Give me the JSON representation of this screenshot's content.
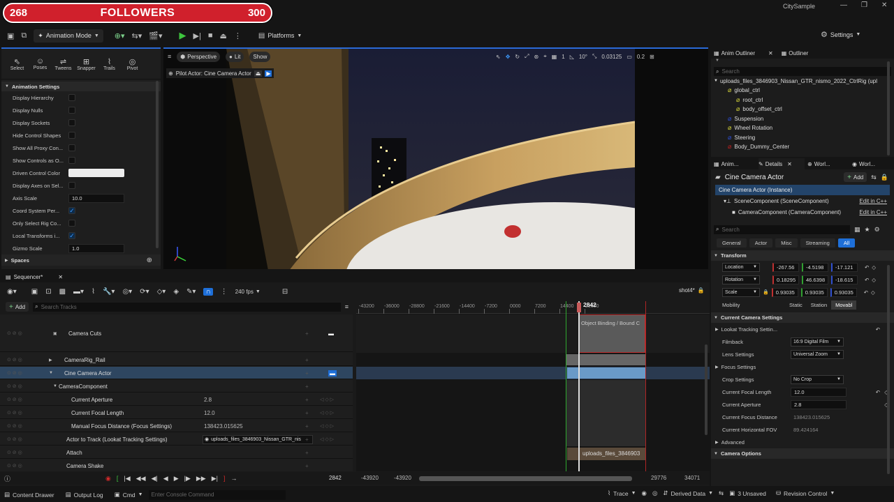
{
  "banner": {
    "left": "268",
    "label": "FOLLOWERS",
    "right": "300",
    "progress": 0.5
  },
  "window": {
    "title": "CitySample"
  },
  "toolbar": {
    "mode": "Animation Mode",
    "platforms": "Platforms",
    "settings": "Settings"
  },
  "anim_panel": {
    "tools": [
      "Select",
      "Poses",
      "Tweens",
      "Snapper",
      "Trails",
      "Pivot"
    ],
    "section": "Animation Settings",
    "rows": [
      {
        "label": "Display Hierarchy",
        "type": "check",
        "checked": false
      },
      {
        "label": "Display Nulls",
        "type": "check",
        "checked": false
      },
      {
        "label": "Display Sockets",
        "type": "check",
        "checked": false
      },
      {
        "label": "Hide Control Shapes",
        "type": "check",
        "checked": false
      },
      {
        "label": "Show All Proxy Con...",
        "type": "check",
        "checked": false
      },
      {
        "label": "Show Controls as O...",
        "type": "check",
        "checked": false
      },
      {
        "label": "Driven Control Color",
        "type": "color"
      },
      {
        "label": "Display Axes on Sel...",
        "type": "check",
        "checked": false
      },
      {
        "label": "Axis Scale",
        "type": "value",
        "value": "10.0"
      },
      {
        "label": "Coord System Per...",
        "type": "check",
        "checked": true
      },
      {
        "label": "Only Select Rig Co...",
        "type": "check",
        "checked": false
      },
      {
        "label": "Local Transforms i...",
        "type": "check",
        "checked": true
      },
      {
        "label": "Gizmo Scale",
        "type": "value",
        "value": "1.0"
      }
    ],
    "spaces": "Spaces"
  },
  "viewport": {
    "perspective": "Perspective",
    "lit": "Lit",
    "show": "Show",
    "pilot": "Pilot Actor: Cine Camera Actor",
    "grid": "1",
    "angle": "10°",
    "scale": "0.03125",
    "speed": "0.2"
  },
  "outliner": {
    "tab1": "Anim Outliner",
    "tab2": "Outliner",
    "search": "Search",
    "root": "uploads_files_3846903_Nissan_GTR_nismo_2022_CtrlRig (upl",
    "items": [
      {
        "label": "global_ctrl",
        "color": "#d8d83a",
        "indent": 1
      },
      {
        "label": "root_ctrl",
        "color": "#d8d83a",
        "indent": 2
      },
      {
        "label": "body_offset_ctrl",
        "color": "#d8d83a",
        "indent": 2
      },
      {
        "label": "Suspension",
        "color": "#2d4fd8",
        "indent": 1
      },
      {
        "label": "Wheel Rotation",
        "color": "#d8d83a",
        "indent": 1
      },
      {
        "label": "Steering",
        "color": "#2d4fd8",
        "indent": 1
      },
      {
        "label": "Body_Dummy_Center",
        "color": "#c02020",
        "indent": 1
      }
    ]
  },
  "details": {
    "tabs": [
      "Anim...",
      "Details",
      "Worl...",
      "Worl..."
    ],
    "title": "Cine Camera Actor",
    "add": "Add",
    "instance": "Cine Camera Actor (Instance)",
    "components": [
      {
        "label": "SceneComponent (SceneComponent)",
        "edit": "Edit in C++"
      },
      {
        "label": "CameraComponent (CameraComponent)",
        "edit": "Edit in C++"
      }
    ],
    "search": "Search",
    "filters": [
      "General",
      "Actor",
      "Misc",
      "Streaming",
      "All"
    ],
    "transform": "Transform",
    "location": {
      "label": "Location",
      "x": "-267.56",
      "y": "-4.5198",
      "z": "-17.121"
    },
    "rotation": {
      "label": "Rotation",
      "x": "0.18295",
      "y": "46.6398",
      "z": "-18.615"
    },
    "scale": {
      "label": "Scale",
      "x": "0.93035",
      "y": "0.93035",
      "z": "0.93035"
    },
    "mobility": {
      "label": "Mobility",
      "options": [
        "Static",
        "Station",
        "Movabl"
      ]
    },
    "camera_settings": "Current Camera Settings",
    "rows": [
      {
        "label": "Lookat Tracking Settin...",
        "value": "",
        "kind": "group"
      },
      {
        "label": "Filmback",
        "value": "16:9 Digital Film",
        "kind": "drop"
      },
      {
        "label": "Lens Settings",
        "value": "Universal Zoom",
        "kind": "drop"
      },
      {
        "label": "Focus Settings",
        "value": "",
        "kind": "group"
      },
      {
        "label": "Crop Settings",
        "value": "No Crop",
        "kind": "drop"
      },
      {
        "label": "Current Focal Length",
        "value": "12.0",
        "kind": "field"
      },
      {
        "label": "Current Aperture",
        "value": "2.8",
        "kind": "field"
      },
      {
        "label": "Current Focus Distance",
        "value": "138423.015625",
        "kind": "ro"
      },
      {
        "label": "Current Horizontal FOV",
        "value": "89.424164",
        "kind": "ro"
      },
      {
        "label": "Advanced",
        "value": "",
        "kind": "group"
      }
    ],
    "camera_options": "Camera Options"
  },
  "sequencer": {
    "tab": "Sequencer*",
    "fps": "240 fps",
    "shot": "shot4*",
    "add": "Add",
    "search": "Search Tracks",
    "frame": "2842",
    "ruler": [
      "-43200",
      "-36000",
      "-28800",
      "-21600",
      "-14400",
      "-7200",
      "0000",
      "7200",
      "14400",
      "21600"
    ],
    "tracks": [
      {
        "label": "Camera Cuts"
      },
      {
        "label": "CameraRig_Rail"
      },
      {
        "label": "Cine Camera Actor"
      },
      {
        "label": "CameraComponent"
      },
      {
        "label": "Current Aperture",
        "value": "2.8"
      },
      {
        "label": "Current Focal Length",
        "value": "12.0"
      },
      {
        "label": "Manual Focus Distance (Focus Settings)",
        "value": "138423.015625"
      },
      {
        "label": "Actor to Track (Lookat Tracking Settings)",
        "value": "uploads_files_3846903_Nissan_GTR_nis"
      },
      {
        "label": "Attach"
      },
      {
        "label": "Camera Shake"
      }
    ],
    "binding": "Object Binding / Bound C",
    "attach_clip": "uploads_files_3846903",
    "range_start": "-43920",
    "range_start2": "-43920",
    "range_end": "29776",
    "range_end2": "34071",
    "current_frame": "2842"
  },
  "status": {
    "content_drawer": "Content Drawer",
    "output_log": "Output Log",
    "cmd": "Cmd",
    "console": "Enter Console Command",
    "trace": "Trace",
    "derived": "Derived Data",
    "unsaved": "3 Unsaved",
    "revision": "Revision Control"
  }
}
